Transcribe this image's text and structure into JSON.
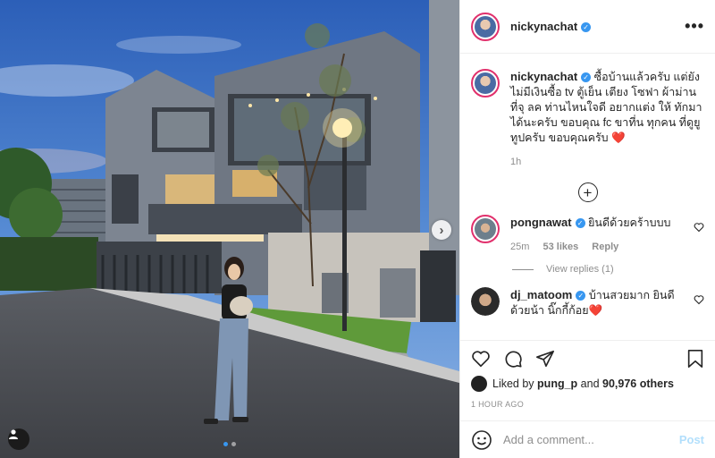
{
  "post": {
    "author": "nickynachat",
    "caption_user": "nickynachat",
    "caption": "ซื้อบ้านแล้วครับ แต่ยังไม่มีเงินซื้อ tv ตู้เย็น เตียง โซฟา ผ้าม่าน ที่จุ ลค ท่านไหนใจดี อยากแต่ง ให้ ทักมาได้นะครับ ขอบคุณ fc ขาที่น ทุกคน ที่ดูยูทูปครับ ขอบคุณครับ",
    "caption_heart": "❤️",
    "caption_time": "1h",
    "more_icon": "•••",
    "likes_user": "pung_p",
    "likes_text_prefix": "Liked by",
    "likes_and": "and",
    "likes_count": "90,976 others",
    "timestamp": "1 HOUR AGO"
  },
  "comments": [
    {
      "user": "pongnawat",
      "text": "ยินดีด้วยคร้าบบบ",
      "time": "25m",
      "likes": "53 likes",
      "reply_label": "Reply",
      "view_replies": "View replies (1)"
    },
    {
      "user": "dj_matoom",
      "text": "บ้านสวยมาก ยินดีด้วยน้า นิ๊กกี้ก้อย",
      "heart": "❤️"
    }
  ],
  "add_comment": {
    "placeholder": "Add a comment...",
    "post_label": "Post"
  },
  "icons": {
    "more": "more-icon",
    "plus": "plus-circle-icon",
    "heart": "heart-icon",
    "comment": "comment-icon",
    "share": "share-icon",
    "save": "bookmark-icon",
    "emoji": "emoji-icon",
    "tag": "user-tag-icon",
    "next": "chevron-right-icon"
  },
  "colors": {
    "verified": "#3897f0",
    "post_button": "#b2dffc",
    "heart": "#ed4956",
    "muted": "#8e8e8e"
  }
}
